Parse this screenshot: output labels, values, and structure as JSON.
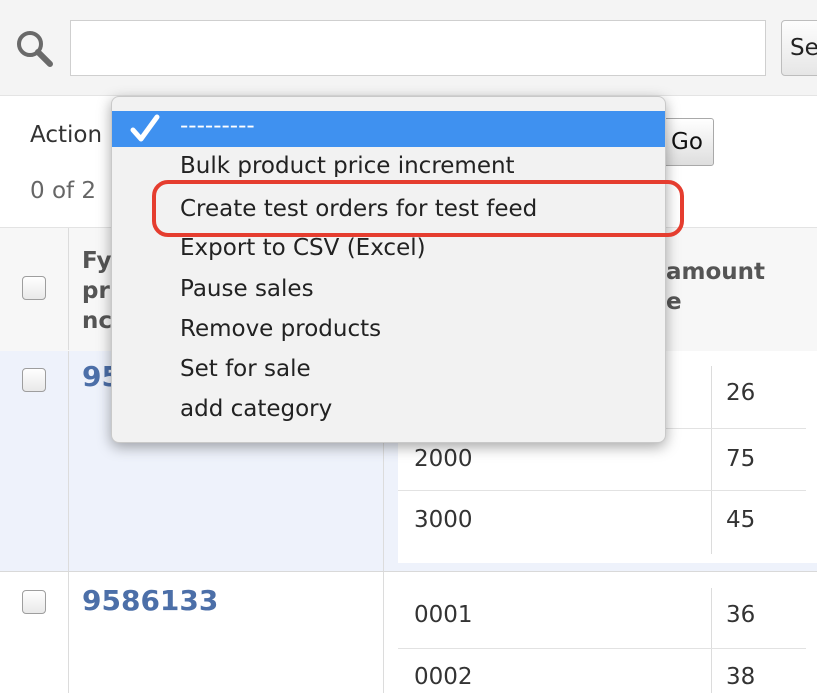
{
  "search": {
    "button_label": "Se",
    "value": ""
  },
  "actions": {
    "label": "Action",
    "go_label": "Go",
    "counter": "0 of 2",
    "dropdown": {
      "selected": "---------",
      "options": [
        "Bulk product price increment",
        "Create test orders for test feed",
        "Export to CSV (Excel)",
        "Pause sales",
        "Remove products",
        "Set for sale",
        "add category"
      ],
      "highlighted_option": "Create test orders for test feed"
    }
  },
  "table": {
    "header": {
      "product_col": [
        "Fy",
        "pr",
        "nc"
      ],
      "amount_col": [
        "amount",
        "e"
      ]
    },
    "rows": [
      {
        "product": "95",
        "subrows": [
          {
            "code": "",
            "amount": "26"
          },
          {
            "code": "2000",
            "amount": "75"
          },
          {
            "code": "3000",
            "amount": "45"
          }
        ]
      },
      {
        "product": "9586133",
        "subrows": [
          {
            "code": "0001",
            "amount": "36"
          },
          {
            "code": "0002",
            "amount": "38"
          }
        ]
      }
    ]
  },
  "colors": {
    "selected_bg": "#3f91f0",
    "link": "#4c6fa8",
    "highlight_border": "#e53d2f",
    "row_highlight": "#eef2fb"
  }
}
